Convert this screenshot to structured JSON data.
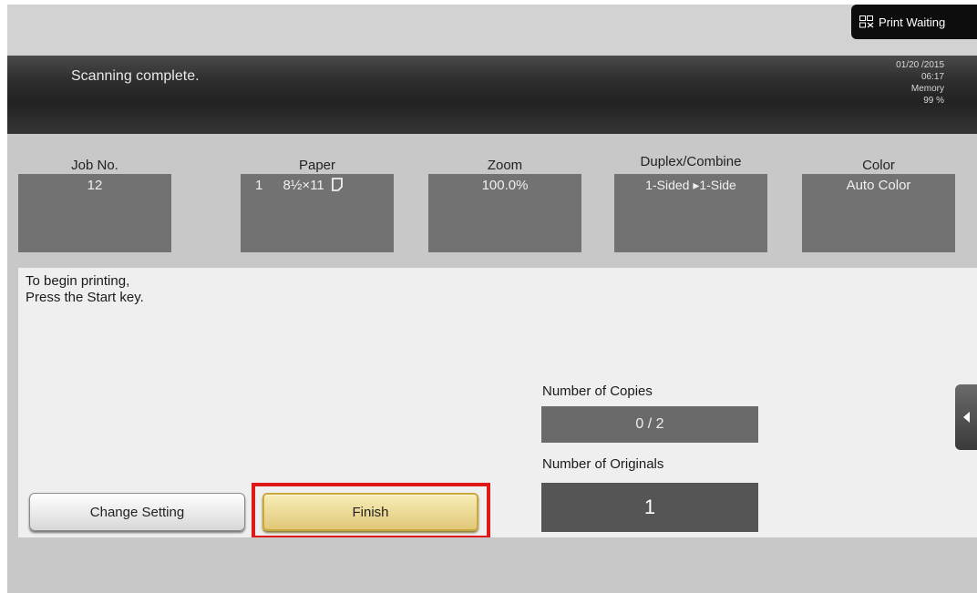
{
  "header": {
    "print_waiting": "Print Waiting",
    "status_message": "Scanning complete.",
    "date": "01/20 /2015",
    "time": "06:17",
    "memory_label": "Memory",
    "memory_value": "99 %"
  },
  "info": [
    {
      "label": "Job No.",
      "value": "12"
    },
    {
      "label": "Paper",
      "tray": "1",
      "size": "8½×11"
    },
    {
      "label": "Zoom",
      "value": "100.0%"
    },
    {
      "label": "Duplex/Combine",
      "value": "1-Sided ▸1-Side"
    },
    {
      "label": "Color",
      "value": "Auto Color"
    }
  ],
  "main": {
    "instruction_line1": "To begin printing,",
    "instruction_line2": "Press the Start key.",
    "copies_label": "Number of Copies",
    "copies_value": "0 / 2",
    "originals_label": "Number of Originals",
    "originals_value": "1",
    "change_setting_label": "Change Setting",
    "finish_label": "Finish"
  },
  "colors": {
    "highlight": "#e01818",
    "finish_button": "#e8d08a",
    "status_bar": "#2b2b2b"
  },
  "icons": {
    "print_waiting": "print-job-icon",
    "paper_orientation": "portrait-page-icon",
    "side_tab": "arrow-left-icon"
  }
}
